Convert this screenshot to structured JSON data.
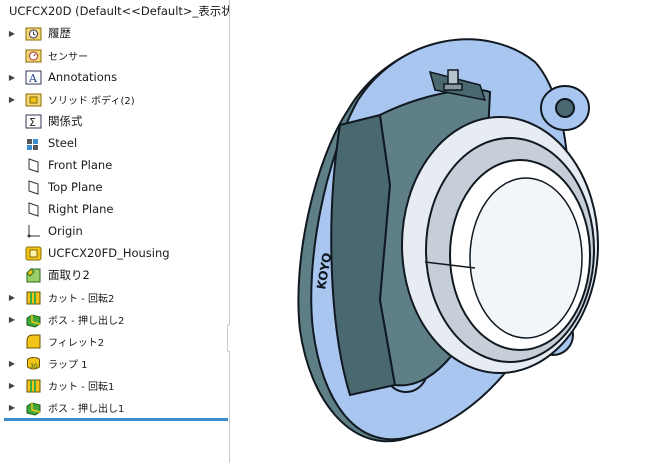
{
  "tree": {
    "root": {
      "label": "UCFCX20D (Default<<Default>_表示状",
      "icon": "part-icon"
    },
    "items": [
      {
        "label": "履歴",
        "icon": "history-folder-icon",
        "expandable": true,
        "small": false
      },
      {
        "label": "センサー",
        "icon": "sensor-icon",
        "expandable": false,
        "small": true
      },
      {
        "label": "Annotations",
        "icon": "annotations-icon",
        "expandable": true,
        "small": false
      },
      {
        "label": "ソリッド ボディ(2)",
        "icon": "solid-bodies-folder-icon",
        "expandable": true,
        "small": true
      },
      {
        "label": "関係式",
        "icon": "equations-icon",
        "expandable": false,
        "small": false
      },
      {
        "label": "Steel",
        "icon": "material-icon",
        "expandable": false,
        "small": false
      },
      {
        "label": "Front Plane",
        "icon": "plane-icon",
        "expandable": false,
        "small": false
      },
      {
        "label": "Top Plane",
        "icon": "plane-icon",
        "expandable": false,
        "small": false
      },
      {
        "label": "Right Plane",
        "icon": "plane-icon",
        "expandable": false,
        "small": false
      },
      {
        "label": "Origin",
        "icon": "origin-icon",
        "expandable": false,
        "small": false
      },
      {
        "label": "UCFCX20FD_Housing",
        "icon": "base-part-icon",
        "expandable": false,
        "small": false
      },
      {
        "label": "面取り2",
        "icon": "chamfer-icon",
        "expandable": false,
        "small": false
      },
      {
        "label": "カット - 回転2",
        "icon": "cut-revolve-icon",
        "expandable": true,
        "small": true
      },
      {
        "label": "ボス - 押し出し2",
        "icon": "boss-extrude-icon",
        "expandable": true,
        "small": true
      },
      {
        "label": "フィレット2",
        "icon": "fillet-icon",
        "expandable": false,
        "small": true
      },
      {
        "label": "ラップ 1",
        "icon": "wrap-icon",
        "expandable": true,
        "small": true
      },
      {
        "label": "カット - 回転1",
        "icon": "cut-revolve-icon",
        "expandable": true,
        "small": true
      },
      {
        "label": "ボス - 押し出し1",
        "icon": "boss-extrude-icon",
        "expandable": true,
        "small": true
      }
    ]
  },
  "viewport": {
    "model_marking": "KOYO",
    "colors": {
      "flange_light": "#a9c6f0",
      "flange_mid": "#7fa8e0",
      "housing_dark": "#4a6870",
      "housing_mid": "#5f7f87",
      "insert_light": "#e6ecf2",
      "insert_shadow": "#c6ced8",
      "edge": "#101820"
    }
  },
  "colors": {
    "rollback_bar": "#3c8dce",
    "accent_yellow": "#f2c418",
    "feature_green": "#3fa93a"
  }
}
